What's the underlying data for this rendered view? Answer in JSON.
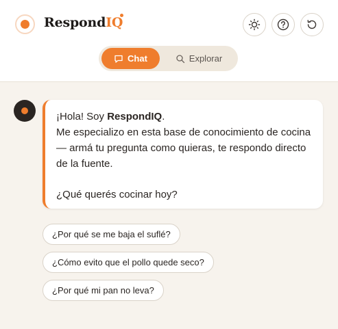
{
  "brand": {
    "name_main": "Respond",
    "name_accent": "IQ"
  },
  "header": {
    "icons": [
      "sun-icon",
      "help-icon",
      "reset-icon"
    ]
  },
  "tabs": [
    {
      "label": "Chat",
      "icon": "chat-bubble-icon",
      "active": true
    },
    {
      "label": "Explorar",
      "icon": "search-icon",
      "active": false
    }
  ],
  "message": {
    "greeting_prefix": "¡Hola! Soy ",
    "greeting_name": "RespondIQ",
    "greeting_suffix": ".",
    "line2": "Me especializo en esta base de conocimiento de cocina",
    "line3": "— armá tu pregunta como quieras, te respondo directo",
    "line4": "de la fuente.",
    "question": "¿Qué querés cocinar hoy?"
  },
  "suggestions": [
    "¿Por qué se me baja el suflé?",
    "¿Cómo evito que el pollo quede seco?",
    "¿Por qué mi pan no leva?"
  ],
  "colors": {
    "accent": "#ef7d2d",
    "dark": "#2a2522",
    "background": "#f7f3ed"
  }
}
